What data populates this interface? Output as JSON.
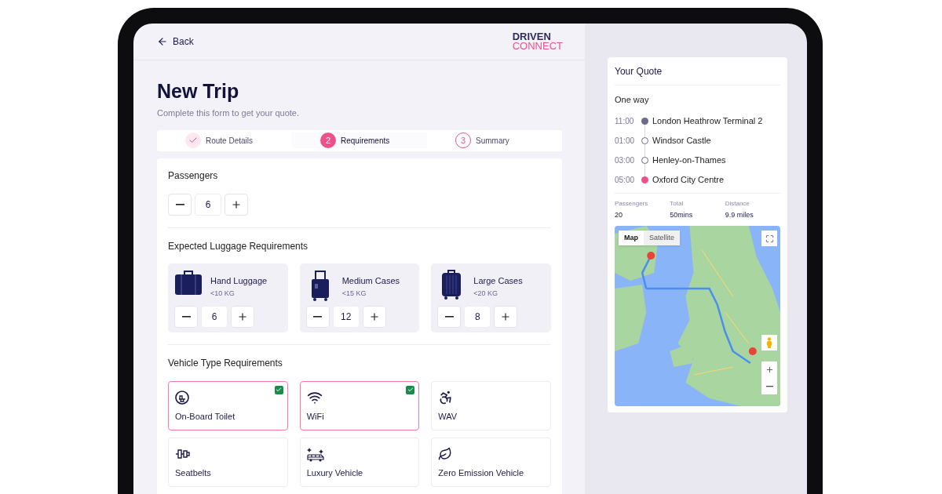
{
  "header": {
    "back": "Back",
    "logo_top": "DRIVEN",
    "logo_bottom": "CONNECT"
  },
  "title": "New Trip",
  "subtitle": "Complete this form to get your quote.",
  "steps": [
    {
      "kind": "done",
      "label": "Route Details",
      "selected": false
    },
    {
      "kind": "current",
      "number": "2",
      "label": "Requirements",
      "selected": true
    },
    {
      "kind": "upcoming",
      "number": "3",
      "label": "Summary",
      "selected": false
    }
  ],
  "passengers": {
    "label": "Passengers",
    "value": "6"
  },
  "luggage": {
    "title": "Expected Luggage Requirements",
    "items": [
      {
        "kind": "hand",
        "name": "Hand Luggage",
        "limit": "<10 KG",
        "value": "6"
      },
      {
        "kind": "medium",
        "name": "Medium Cases",
        "limit": "<15 KG",
        "value": "12"
      },
      {
        "kind": "large",
        "name": "Large Cases",
        "limit": "<20 KG",
        "value": "8"
      }
    ]
  },
  "vehicle": {
    "title": "Vehicle Type Requirements",
    "options": [
      {
        "kind": "toilet",
        "label": "On-Board Toilet",
        "checked": true
      },
      {
        "kind": "wifi",
        "label": "WiFi",
        "checked": true
      },
      {
        "kind": "wheelchair",
        "label": "WAV",
        "checked": false
      },
      {
        "kind": "seatbelt",
        "label": "Seatbelts",
        "checked": false
      },
      {
        "kind": "luxury",
        "label": "Luxury Vehicle",
        "checked": false
      },
      {
        "kind": "leaf",
        "label": "Zero Emission Vehicle",
        "checked": false
      }
    ]
  },
  "quote": {
    "title": "Your Quote",
    "trip_type": "One way",
    "stops": [
      {
        "kind": "origin",
        "time": "11:00",
        "place": "London Heathrow Terminal 2"
      },
      {
        "kind": "stop",
        "time": "01:00",
        "place": "Windsor Castle"
      },
      {
        "kind": "stop",
        "time": "03:00",
        "place": "Henley-on-Thames"
      },
      {
        "kind": "destination",
        "time": "05:00",
        "place": "Oxford City Centre"
      }
    ],
    "stats": [
      {
        "label": "Passengers",
        "value": "20"
      },
      {
        "label": "Total",
        "value": "50mins"
      },
      {
        "label": "Distance",
        "value": "9.9 miles"
      }
    ],
    "map": {
      "kind": "picture",
      "types": [
        {
          "label": "Map",
          "selected": true
        },
        {
          "label": "Satellite",
          "selected": false
        }
      ]
    }
  }
}
